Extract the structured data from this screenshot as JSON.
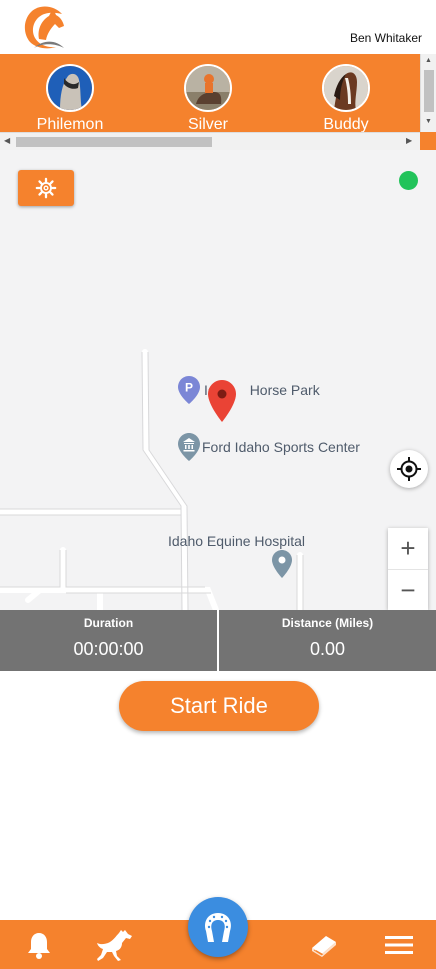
{
  "header": {
    "user_name": "Ben Whitaker",
    "logo_icon": "horse-head-logo-icon"
  },
  "horses": [
    {
      "name": "Philemon",
      "avatar_icon": "horse-photo-icon"
    },
    {
      "name": "Silver",
      "avatar_icon": "rider-photo-icon"
    },
    {
      "name": "Buddy",
      "avatar_icon": "horse-photo-icon"
    }
  ],
  "map": {
    "settings_icon": "gear-icon",
    "status": "online",
    "places": [
      {
        "name": "Idaho Horse Park",
        "visible_prefix": "Id",
        "visible_suffix": "Horse Park",
        "icon": "parking-icon"
      },
      {
        "name": "Ford Idaho Sports Center",
        "icon": "museum-pin-icon"
      },
      {
        "name": "Idaho Equine Hospital",
        "icon": "pin-icon"
      }
    ],
    "zoom_in": "+",
    "zoom_out": "−"
  },
  "stats": {
    "duration_label": "Duration",
    "duration_value": "00:00:00",
    "distance_label": "Distance (Miles)",
    "distance_value": "0.00"
  },
  "actions": {
    "start_ride": "Start Ride"
  },
  "bottom_nav": [
    {
      "icon": "bell-icon"
    },
    {
      "icon": "horse-icon"
    },
    {
      "icon": "horseshoe-icon"
    },
    {
      "icon": "book-icon"
    },
    {
      "icon": "menu-icon"
    }
  ],
  "colors": {
    "brand_orange": "#f5822d",
    "stat_gray": "#737373",
    "status_green": "#22c35a",
    "accent_blue": "#3b8de0"
  }
}
